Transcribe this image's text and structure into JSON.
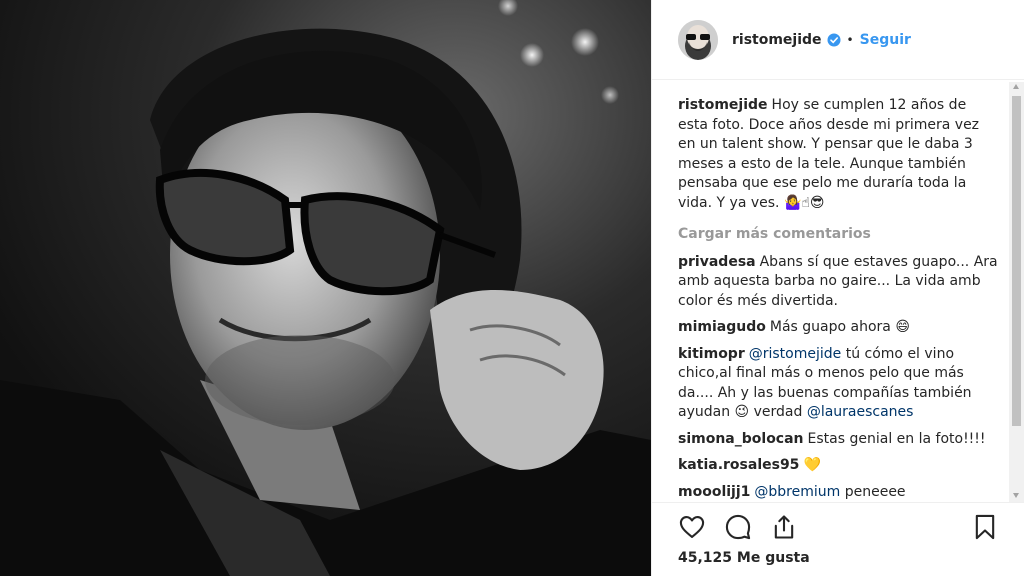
{
  "post": {
    "username": "ristomejide",
    "separator": "•",
    "follow_label": "Seguir",
    "caption": "Hoy se cumplen 12 años de esta foto. Doce años desde mi primera vez en un talent show. Y pensar que le daba 3 meses a esto de la tele. Aunque también pensaba que ese pelo me duraría toda la vida. Y ya ves. ",
    "caption_emoji": "🤷‍♀️☝😎",
    "load_more": "Cargar más comentarios",
    "likes": "45,125 Me gusta"
  },
  "comments": [
    {
      "user": "privadesa",
      "text": "Abans sí que estaves guapo... Ara amb aquesta barba no gaire... La vida amb color és més divertida."
    },
    {
      "user": "mimiagudo",
      "text": "Más guapo ahora",
      "emoji": "😄"
    },
    {
      "user": "kitimopr",
      "mention": "@ristomejide",
      "text": " tú cómo el vino chico,al final más o menos pelo que más da.... Ah y las buenas compañías también ayudan ",
      "emoji": "😉",
      "text2": " verdad ",
      "mention2": "@lauraescanes"
    },
    {
      "user": "simona_bolocan",
      "text": "Estas genial en la foto!!!!"
    },
    {
      "user": "katia.rosales95",
      "text": "",
      "emoji": "💛"
    },
    {
      "user": "mooolijj1",
      "mention": "@bbremium",
      "text": " peneeee"
    }
  ],
  "colors": {
    "link": "#3897f0",
    "verified": "#3897f0",
    "mention": "#003569",
    "muted": "#999999"
  },
  "icons": [
    "heart-icon",
    "comment-icon",
    "share-icon",
    "bookmark-icon",
    "verified-badge-icon"
  ]
}
